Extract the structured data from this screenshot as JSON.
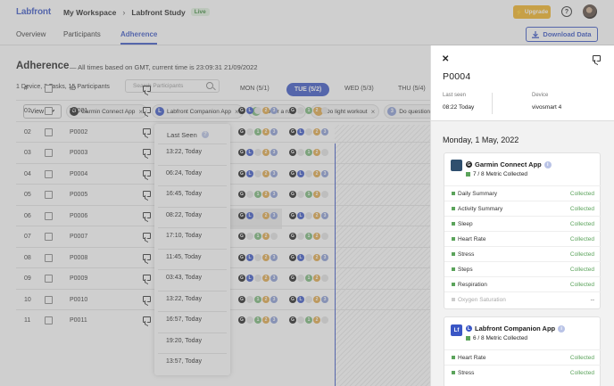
{
  "topbar": {
    "logo": "Labfront",
    "workspace": "My Workspace",
    "study": "Labfront Study",
    "live_badge": "Live",
    "upgrade_label": "Upgrade",
    "help_label": "?"
  },
  "tabs": [
    {
      "label": "Overview"
    },
    {
      "label": "Participants"
    },
    {
      "label": "Adherence"
    }
  ],
  "download_label": "Download Data",
  "adherence": {
    "title": "Adherence",
    "subtitle": "— All times based on GMT, current time is 23:09:31 21/09/2022",
    "counts": "1 Device, 3 Tasks, 15 Participants",
    "search_placeholder": "Search Participants",
    "view_label": "View",
    "filters": [
      {
        "icon": "G",
        "label": "Garmin Connect App",
        "color": "#222222"
      },
      {
        "icon": "L",
        "label": "Labfront Companion App",
        "color": "#3a56c5"
      },
      {
        "icon": "1",
        "label": "Go for a run",
        "color": "#7ab87a"
      },
      {
        "icon": "2",
        "label": "Do light workout",
        "color": "#e0a84a"
      },
      {
        "icon": "3",
        "label": "Do questionna",
        "color": "#8b9dd6"
      }
    ]
  },
  "table": {
    "col_num": "#",
    "col_id": "ID",
    "col_last_seen": "Last Seen",
    "last_seen_info": "?",
    "days": [
      "MON (5/1)",
      "TUE (5/2)",
      "WED (5/3)",
      "THU (5/4)"
    ],
    "rows": [
      {
        "num": "01",
        "id": "P0001",
        "last_seen": "13:22, Today",
        "mon": [
          1,
          1,
          0,
          1,
          1
        ],
        "tue": [
          1,
          0,
          1,
          1,
          0
        ]
      },
      {
        "num": "02",
        "id": "P0002",
        "last_seen": "06:24, Today",
        "mon": [
          1,
          0,
          1,
          1,
          1
        ],
        "tue": [
          1,
          1,
          0,
          1,
          1
        ]
      },
      {
        "num": "03",
        "id": "P0003",
        "last_seen": "16:45, Today",
        "mon": [
          1,
          1,
          0,
          1,
          1
        ],
        "tue": [
          1,
          0,
          1,
          1,
          0
        ]
      },
      {
        "num": "04",
        "id": "P0004",
        "last_seen": "08:22, Today",
        "mon": [
          1,
          1,
          0,
          1,
          1
        ],
        "tue": [
          1,
          1,
          0,
          1,
          1
        ]
      },
      {
        "num": "05",
        "id": "P0005",
        "last_seen": "17:10, Today",
        "mon": [
          1,
          0,
          1,
          1,
          1
        ],
        "tue": [
          1,
          0,
          1,
          1,
          0
        ]
      },
      {
        "num": "06",
        "id": "P0006",
        "last_seen": "11:45, Today",
        "mon": [
          1,
          1,
          0,
          1,
          1
        ],
        "tue": [
          1,
          1,
          0,
          1,
          1
        ]
      },
      {
        "num": "07",
        "id": "P0007",
        "last_seen": "03:43, Today",
        "mon": [
          1,
          0,
          1,
          1,
          0
        ],
        "tue": [
          1,
          0,
          1,
          1,
          0
        ]
      },
      {
        "num": "08",
        "id": "P0008",
        "last_seen": "13:22, Today",
        "mon": [
          1,
          1,
          0,
          1,
          1
        ],
        "tue": [
          1,
          1,
          0,
          1,
          1
        ]
      },
      {
        "num": "09",
        "id": "P0009",
        "last_seen": "16:57, Today",
        "mon": [
          1,
          1,
          0,
          1,
          1
        ],
        "tue": [
          1,
          0,
          1,
          1,
          0
        ]
      },
      {
        "num": "10",
        "id": "P0010",
        "last_seen": "19:20, Today",
        "mon": [
          1,
          0,
          1,
          1,
          1
        ],
        "tue": [
          1,
          1,
          0,
          1,
          1
        ]
      },
      {
        "num": "11",
        "id": "P0011",
        "last_seen": "13:57, Today",
        "mon": [
          1,
          0,
          1,
          1,
          1
        ],
        "tue": [
          1,
          0,
          1,
          1,
          0
        ]
      }
    ]
  },
  "panel": {
    "participant_id": "P0004",
    "last_seen_label": "Last seen",
    "last_seen_value": "08:22 Today",
    "device_label": "Device",
    "device_value": "vivosmart 4",
    "date": "Monday, 1 May, 2022",
    "apps": [
      {
        "name": "Garmin Connect App",
        "count": "7 / 8 Metric Collected",
        "metrics": [
          {
            "name": "Daily Summary",
            "status": "Collected",
            "collected": true
          },
          {
            "name": "Activity Summary",
            "status": "Collected",
            "collected": true
          },
          {
            "name": "Sleep",
            "status": "Collected",
            "collected": true
          },
          {
            "name": "Heart Rate",
            "status": "Collected",
            "collected": true
          },
          {
            "name": "Stress",
            "status": "Collected",
            "collected": true
          },
          {
            "name": "Steps",
            "status": "Collected",
            "collected": true
          },
          {
            "name": "Respiration",
            "status": "Collected",
            "collected": true
          },
          {
            "name": "Oxygen Saturation",
            "status": "--",
            "collected": false
          }
        ]
      },
      {
        "name": "Labfront Companion App",
        "count": "6 / 8 Metric Collected",
        "metrics": [
          {
            "name": "Heart Rate",
            "status": "Collected",
            "collected": true
          },
          {
            "name": "Stress",
            "status": "Collected",
            "collected": true
          }
        ]
      }
    ]
  }
}
